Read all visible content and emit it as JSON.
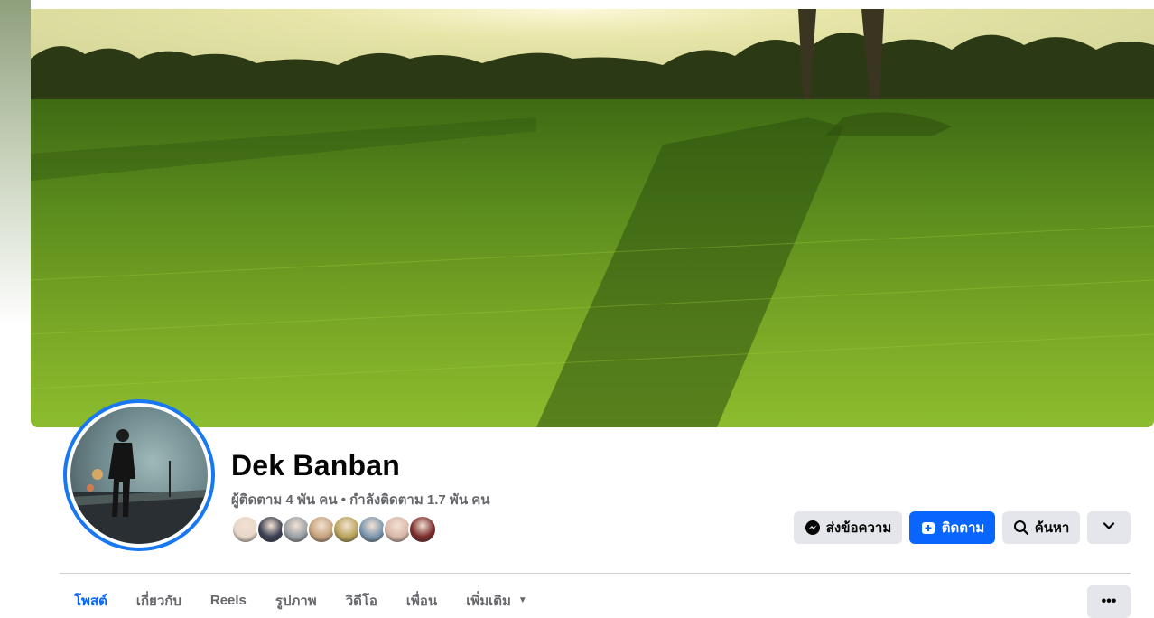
{
  "profile": {
    "name": "Dek Banban",
    "stats": "ผู้ติดตาม 4 พัน คน • กำลังติดตาม 1.7 พัน คน",
    "friend_avatars": [
      {
        "color": "#e7d7c9"
      },
      {
        "color": "#3a3f52"
      },
      {
        "color": "#9aa0a6"
      },
      {
        "color": "#c6a27c"
      },
      {
        "color": "#b9a35a"
      },
      {
        "color": "#7a96b0"
      },
      {
        "color": "#d9b7a8"
      },
      {
        "color": "#7b2b2b"
      }
    ]
  },
  "actions": {
    "message_label": "ส่งข้อความ",
    "follow_label": "ติดตาม",
    "search_label": "ค้นหา",
    "more_icon": "chevron-down-icon"
  },
  "tabs": {
    "items": [
      {
        "label": "โพสต์"
      },
      {
        "label": "เกี่ยวกับ"
      },
      {
        "label": "Reels"
      },
      {
        "label": "รูปภาพ"
      },
      {
        "label": "วิดีโอ"
      },
      {
        "label": "เพื่อน"
      },
      {
        "label": "เพิ่มเติม"
      }
    ],
    "more_menu_glyph": "•••"
  },
  "colors": {
    "accent": "#0866ff",
    "ring": "#1877f2",
    "button_gray": "#e4e6eb",
    "muted_text": "#65676b"
  }
}
